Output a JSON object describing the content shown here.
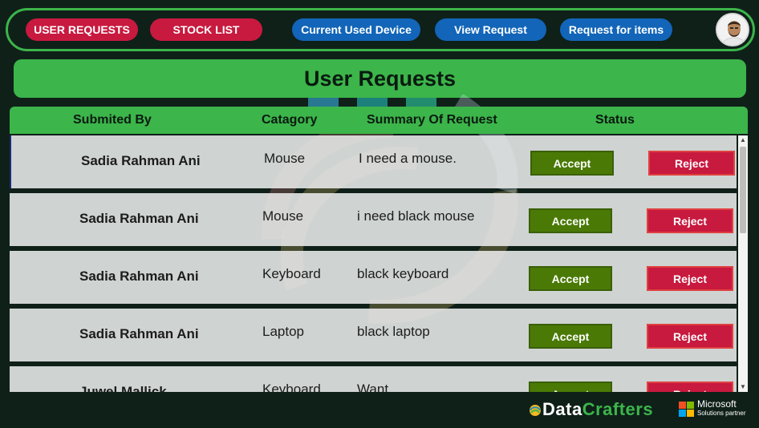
{
  "nav": {
    "user_requests": "USER REQUESTS",
    "stock_list": "STOCK LIST",
    "current_used_device": "Current Used Device",
    "view_request": "View Request",
    "request_for_items": "Request for items"
  },
  "page_title": "User Requests",
  "table": {
    "headers": {
      "submitted_by": "Submited By",
      "category": "Catagory",
      "summary": "Summary Of Request",
      "status": "Status"
    },
    "rows": [
      {
        "name": "Sadia Rahman Ani",
        "category": "Mouse",
        "summary": "I need a mouse.",
        "accept": "Accept",
        "reject": "Reject"
      },
      {
        "name": "Sadia Rahman Ani",
        "category": "Mouse",
        "summary": "i need black mouse",
        "accept": "Accept",
        "reject": "Reject"
      },
      {
        "name": "Sadia Rahman Ani",
        "category": "Keyboard",
        "summary": "black keyboard",
        "accept": "Accept",
        "reject": "Reject"
      },
      {
        "name": "Sadia Rahman Ani",
        "category": "Laptop",
        "summary": "black laptop",
        "accept": "Accept",
        "reject": "Reject"
      },
      {
        "name": "Juwel Mallick",
        "category": "Keyboard",
        "summary": "Want",
        "accept": "Accept",
        "reject": "Reject"
      }
    ]
  },
  "footer": {
    "brand_data": "Data",
    "brand_crafters": "Crafters",
    "partner_name": "Microsoft",
    "partner_sub": "Solutions partner"
  },
  "colors": {
    "accent_green": "#3cb54a",
    "nav_red": "#c8193f",
    "nav_blue": "#1265b8",
    "accept_green": "#4a7a05",
    "background": "#0f2019"
  }
}
